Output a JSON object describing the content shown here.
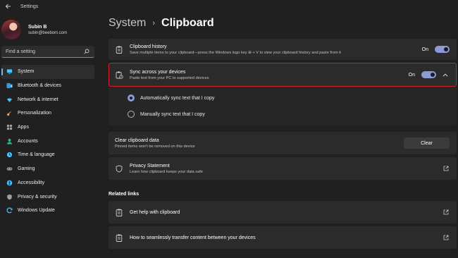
{
  "window": {
    "title": "Settings"
  },
  "profile": {
    "name": "Subin B",
    "email": "subin@beebom.com"
  },
  "search": {
    "placeholder": "Find a setting"
  },
  "sidebar": {
    "items": [
      {
        "label": "System",
        "icon": "monitor-icon",
        "color": "#4cc2ff",
        "active": true
      },
      {
        "label": "Bluetooth & devices",
        "icon": "bluetooth-icon",
        "color": "#3a96dd"
      },
      {
        "label": "Network & internet",
        "icon": "wifi-icon",
        "color": "#4cc2ff"
      },
      {
        "label": "Personalization",
        "icon": "brush-icon",
        "color": "#f7a23b"
      },
      {
        "label": "Apps",
        "icon": "apps-icon",
        "color": "#9aa0a6"
      },
      {
        "label": "Accounts",
        "icon": "person-icon",
        "color": "#2fb67c"
      },
      {
        "label": "Time & language",
        "icon": "globe-clock-icon",
        "color": "#4cc2ff"
      },
      {
        "label": "Gaming",
        "icon": "gamepad-icon",
        "color": "#9aa0a6"
      },
      {
        "label": "Accessibility",
        "icon": "accessibility-icon",
        "color": "#4cc2ff"
      },
      {
        "label": "Privacy & security",
        "icon": "shield-icon",
        "color": "#9aa0a6"
      },
      {
        "label": "Windows Update",
        "icon": "update-icon",
        "color": "#4cc2ff"
      }
    ]
  },
  "header": {
    "parent": "System",
    "separator": "›",
    "current": "Clipboard"
  },
  "settings": {
    "history": {
      "title": "Clipboard history",
      "subtitle": "Save multiple items to your clipboard—press the Windows logo key ⊞ + V to view your clipboard history and paste from it",
      "state": "On"
    },
    "sync": {
      "title": "Sync across your devices",
      "subtitle": "Paste text from your PC to supported devices",
      "state": "On",
      "options": [
        {
          "label": "Automatically sync text that I copy",
          "checked": true
        },
        {
          "label": "Manually sync text that I copy",
          "checked": false
        }
      ]
    },
    "clear": {
      "title": "Clear clipboard data",
      "subtitle": "Pinned items won't be removed on this device",
      "button": "Clear"
    },
    "privacy": {
      "title": "Privacy Statement",
      "subtitle": "Learn how clipboard keeps your data safe"
    }
  },
  "related": {
    "heading": "Related links",
    "links": [
      {
        "label": "Get help with clipboard"
      },
      {
        "label": "How to seamlessly transfer content between your devices"
      }
    ]
  },
  "colors": {
    "accent": "#8c9bd6",
    "highlight_border": "#d3202a",
    "background": "#202020",
    "card": "#2b2b2b"
  }
}
